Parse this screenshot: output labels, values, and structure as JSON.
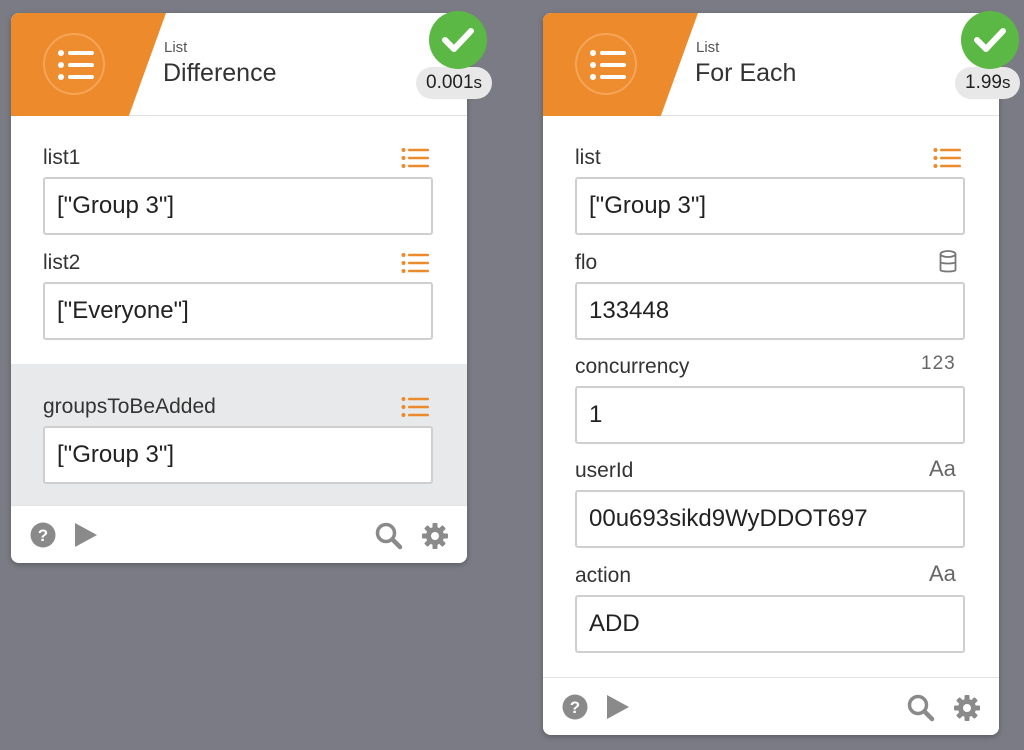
{
  "colors": {
    "accent": "#ec8a2c",
    "success": "#5cb844",
    "background": "#7b7b85"
  },
  "cards": [
    {
      "subtitle": "List",
      "title": "Difference",
      "status_icon": "check-icon",
      "timing_value": "0.001",
      "timing_unit": "s",
      "inputs": [
        {
          "label": "list1",
          "value": "[\"Group 3\"]",
          "type_icon": "list-icon"
        },
        {
          "label": "list2",
          "value": "[\"Everyone\"]",
          "type_icon": "list-icon"
        }
      ],
      "outputs": [
        {
          "label": "groupsToBeAdded",
          "value": "[\"Group 3\"]",
          "type_icon": "list-icon"
        }
      ],
      "footer": {
        "help_icon": "help-icon",
        "run_icon": "play-icon",
        "search_icon": "search-icon",
        "settings_icon": "gear-icon"
      }
    },
    {
      "subtitle": "List",
      "title": "For Each",
      "status_icon": "check-icon",
      "timing_value": "1.99",
      "timing_unit": "s",
      "inputs": [
        {
          "label": "list",
          "value": "[\"Group 3\"]",
          "type_icon": "list-icon"
        },
        {
          "label": "flo",
          "value": "133448",
          "type_icon": "database-icon"
        },
        {
          "label": "concurrency",
          "value": "1",
          "type_icon": "number-icon",
          "type_text": "123"
        },
        {
          "label": "userId",
          "value": "00u693sikd9WyDDOT697",
          "type_icon": "text-icon",
          "type_text": "Aa"
        },
        {
          "label": "action",
          "value": "ADD",
          "type_icon": "text-icon",
          "type_text": "Aa"
        }
      ],
      "footer": {
        "help_icon": "help-icon",
        "run_icon": "play-icon",
        "search_icon": "search-icon",
        "settings_icon": "gear-icon"
      }
    }
  ]
}
